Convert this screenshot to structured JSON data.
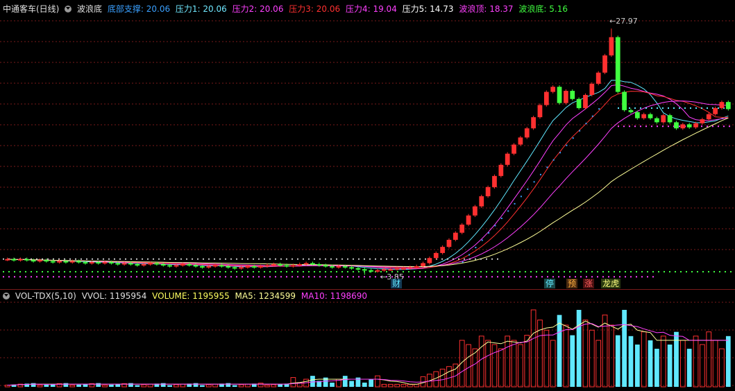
{
  "header": {
    "stock_name": "中通客车(日线)",
    "indicator_name": "波浪底",
    "items": [
      {
        "label": "底部支撑: 20.06",
        "color": "#3aa0ff"
      },
      {
        "label": "压力1: 20.06",
        "color": "#70e8ff"
      },
      {
        "label": "压力2: 20.06",
        "color": "#ff40ff"
      },
      {
        "label": "压力3: 20.06",
        "color": "#ff3030"
      },
      {
        "label": "压力4: 19.04",
        "color": "#ff40ff"
      },
      {
        "label": "压力5: 14.73",
        "color": "#ffffff"
      },
      {
        "label": "波浪顶: 18.37",
        "color": "#ff40ff"
      },
      {
        "label": "波浪底: 5.16",
        "color": "#40ff40"
      }
    ]
  },
  "annotations": {
    "peak": "27.97",
    "low": "3.85",
    "tag_cai": "财",
    "tag_ting": "停",
    "tag_yu": "预",
    "tag_zhang": "涨",
    "tag_longhu": "龙虎"
  },
  "vol_header": {
    "indicator": "VOL-TDX(5,10)",
    "vvol": "VVOL: 1195954",
    "volume": "VOLUME: 1195955",
    "ma5": "MA5: 1234599",
    "ma10": "MA10: 1198690"
  },
  "colors": {
    "up": "#ff3030",
    "down": "#40ff40",
    "vol_down": "#60e8ff",
    "grid": "#7a1a1a",
    "ma_white": "#ffff99",
    "ma_magenta": "#ff40ff"
  },
  "chart_data": {
    "type": "candlestick",
    "price_range": [
      3.5,
      29.5
    ],
    "peak_value": 27.97,
    "low_value": 3.85,
    "closes": [
      5.3,
      5.2,
      5.3,
      5.2,
      5.1,
      5.2,
      5.1,
      5.0,
      5.1,
      5.0,
      5.1,
      5.0,
      4.9,
      5.0,
      4.9,
      5.0,
      4.9,
      4.8,
      4.9,
      4.8,
      4.7,
      4.8,
      4.9,
      4.8,
      4.7,
      4.6,
      4.7,
      4.8,
      4.7,
      4.6,
      4.5,
      4.6,
      4.7,
      4.6,
      4.5,
      4.4,
      4.5,
      4.6,
      4.5,
      4.6,
      4.7,
      4.8,
      4.7,
      4.6,
      4.7,
      4.8,
      4.9,
      4.8,
      4.7,
      4.6,
      4.5,
      4.6,
      4.5,
      4.4,
      4.3,
      4.2,
      4.1,
      4.2,
      4.3,
      4.3,
      4.4,
      4.4,
      4.5,
      4.6,
      4.9,
      5.4,
      5.9,
      6.5,
      7.2,
      7.9,
      8.7,
      9.6,
      10.5,
      11.5,
      12.4,
      13.5,
      14.6,
      15.7,
      16.6,
      17.3,
      18.2,
      19.3,
      20.5,
      21.8,
      22.3,
      20.7,
      21.9,
      21.1,
      20.2,
      21.5,
      22.6,
      23.7,
      25.4,
      27.2,
      21.8,
      20.0,
      19.8,
      19.2,
      19.6,
      19.2,
      18.8,
      19.5,
      18.8,
      18.2,
      18.6,
      18.3,
      18.7,
      19.1,
      19.6,
      20.2,
      20.8,
      20.1
    ]
  }
}
